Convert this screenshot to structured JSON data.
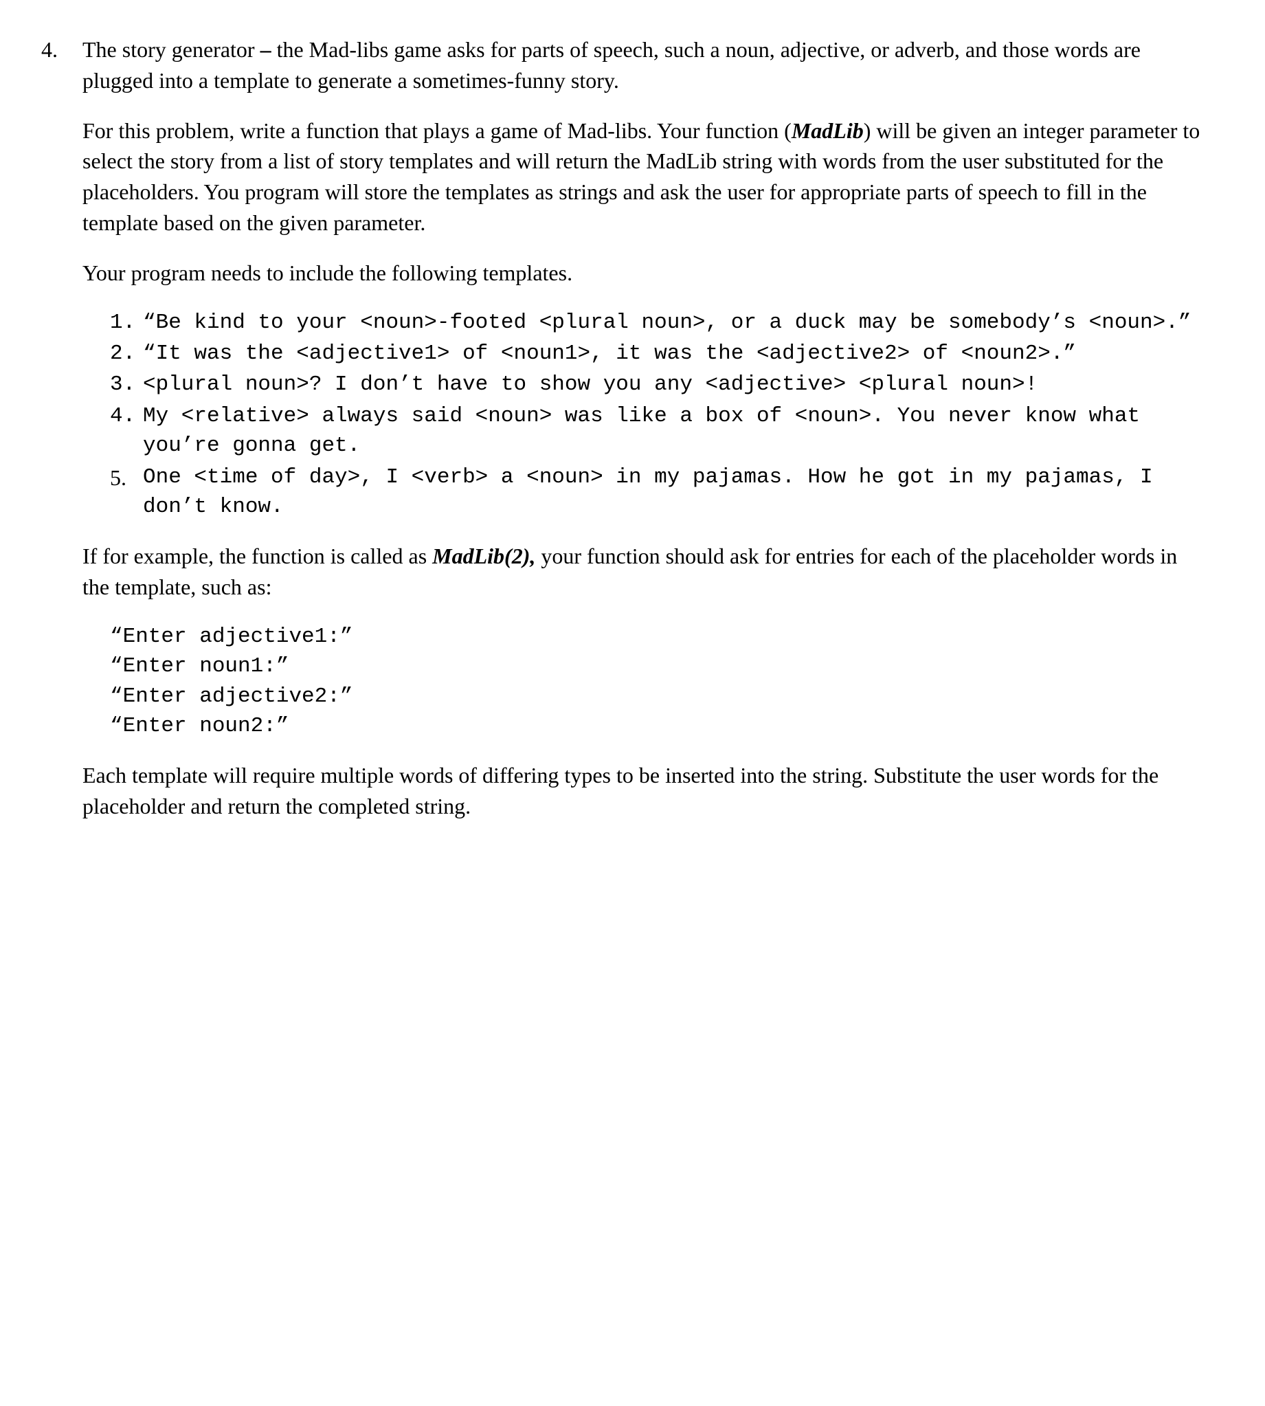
{
  "problem": {
    "number": "4.",
    "intro": "The story generator – the Mad-libs game asks for parts of speech, such a noun, adjective, or adverb, and those words are plugged into a template to generate a sometimes-funny story.",
    "para2_prefix": "For this problem, write a function that plays a game of Mad-libs. Your function (",
    "funcname": "MadLib",
    "para2_suffix": ") will be given an integer parameter to select the story from a list of story templates and will return the MadLib string with words from the user substituted for the placeholders.  You program will store the templates as strings and ask the user for appropriate parts of speech to fill in the template based on the given parameter.",
    "para3": "Your program needs to include the following templates.",
    "templates": [
      {
        "n": "1.",
        "sans": false,
        "text": "“Be kind to your <noun>-footed <plural noun>, or a duck may be somebody’s <noun>.”"
      },
      {
        "n": "2.",
        "sans": false,
        "text": "“It was the <adjective1> of <noun1>, it was the <adjective2> of <noun2>.”"
      },
      {
        "n": "3.",
        "sans": false,
        "text": "<plural noun>? I don’t have to show you any <adjective> <plural noun>!"
      },
      {
        "n": "4.",
        "sans": false,
        "text": "My <relative> always said <noun> was like a box of <noun>. You never know what you’re gonna get."
      },
      {
        "n": "5.",
        "sans": true,
        "text": "One <time of day>, I <verb> a <noun> in my pajamas. How he got in my pajamas, I don’t know."
      }
    ],
    "para4_prefix": "If for example, the function is called as ",
    "callexpr": "MadLib(2),",
    "para4_suffix": " your function should ask for entries for each of the placeholder words in the template, such as:",
    "prompts": [
      "“Enter adjective1:”",
      "“Enter noun1:”",
      "“Enter adjective2:”",
      "“Enter noun2:”"
    ],
    "para5": "Each template will require multiple words of differing types to be inserted into the string. Substitute the user words for the placeholder and return the completed string."
  }
}
